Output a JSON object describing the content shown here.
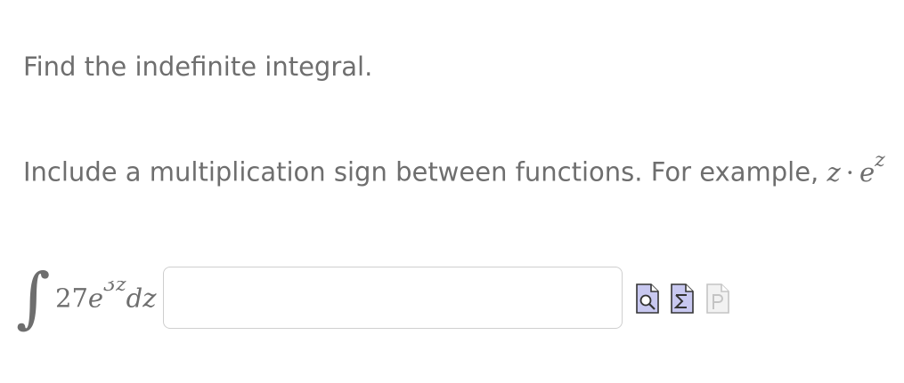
{
  "question": {
    "prompt": "Find the indefinite integral.",
    "hint_prefix": "Include a multiplication sign between functions. For example,",
    "hint_example": {
      "left": "z",
      "operator": "·",
      "base": "e",
      "exponent": "z"
    }
  },
  "integral": {
    "sign": "∫",
    "coefficient": "27",
    "base": "e",
    "exponent": "3z",
    "differential": "dz"
  },
  "answer": {
    "value": "",
    "placeholder": ""
  },
  "tools": [
    {
      "name": "preview",
      "icon": "document-magnifier-icon",
      "enabled": true
    },
    {
      "name": "equation-editor",
      "icon": "document-sigma-icon",
      "enabled": true
    },
    {
      "name": "pdf",
      "icon": "document-p-icon",
      "enabled": false
    }
  ],
  "colors": {
    "text": "#6e6e6e",
    "input_border": "#cfcfcf",
    "tool_fill": "#c8c8f0",
    "tool_stroke": "#333333",
    "tool_disabled": "#c4c4c4"
  }
}
